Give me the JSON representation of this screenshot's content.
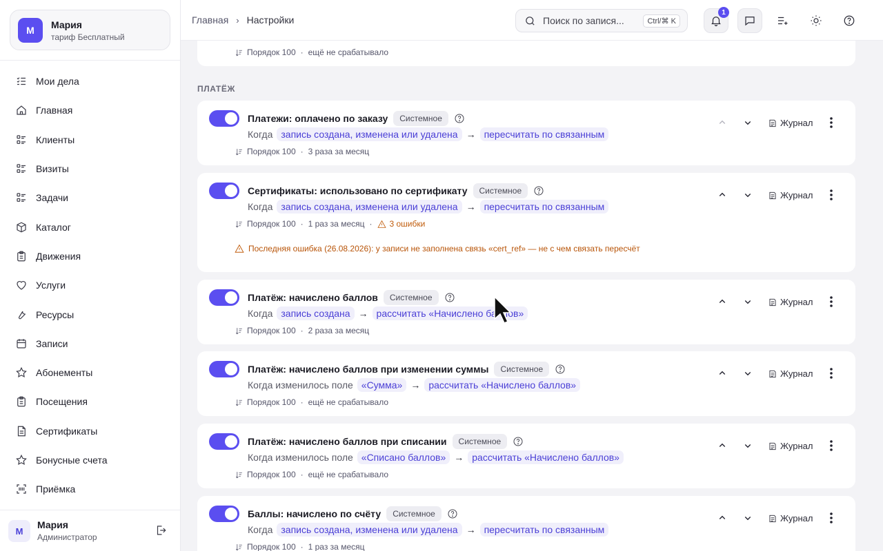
{
  "account": {
    "avatar": "М",
    "name": "Мария",
    "plan": "тариф Бесплатный"
  },
  "nav": [
    {
      "label": "Мои дела",
      "icon": "checklist-icon"
    },
    {
      "label": "Главная",
      "icon": "home-icon"
    },
    {
      "label": "Клиенты",
      "icon": "list-icon"
    },
    {
      "label": "Визиты",
      "icon": "list-icon"
    },
    {
      "label": "Задачи",
      "icon": "list-icon"
    },
    {
      "label": "Каталог",
      "icon": "box-icon"
    },
    {
      "label": "Движения",
      "icon": "clipboard-icon"
    },
    {
      "label": "Услуги",
      "icon": "heart-icon"
    },
    {
      "label": "Ресурсы",
      "icon": "wrench-icon"
    },
    {
      "label": "Записи",
      "icon": "calendar-icon"
    },
    {
      "label": "Абонементы",
      "icon": "star-icon"
    },
    {
      "label": "Посещения",
      "icon": "clipboard-icon"
    },
    {
      "label": "Сертификаты",
      "icon": "document-icon"
    },
    {
      "label": "Бонусные счета",
      "icon": "star-icon"
    },
    {
      "label": "Приёмка",
      "icon": "scan-icon"
    }
  ],
  "user": {
    "avatar": "М",
    "name": "Мария",
    "role": "Администратор"
  },
  "breadcrumb": {
    "home": "Главная",
    "current": "Настройки"
  },
  "search": {
    "placeholder": "Поиск по запися...",
    "shortcut": "Ctrl/⌘ K"
  },
  "notifications": {
    "count": "1"
  },
  "section": "ПЛАТЁЖ",
  "top_partial": {
    "order": "Порядок 100",
    "runs": "ещё не срабатывало"
  },
  "rules": [
    {
      "title": "Платежи: оплачено по заказу",
      "badge": "Системное",
      "when": "Когда",
      "trigger": "запись создана, изменена или удалена",
      "action": "пересчитать по связанным",
      "order": "Порядок 100",
      "runs": "3 раза за месяц",
      "up_disabled": true
    },
    {
      "title": "Сертификаты: использовано по сертификату",
      "badge": "Системное",
      "when": "Когда",
      "trigger": "запись создана, изменена или удалена",
      "action": "пересчитать по связанным",
      "order": "Порядок 100",
      "runs": "1 раз за месяц",
      "errors": "3 ошибки",
      "last_error": "Последняя ошибка (26.08.2026): у записи не заполнена связь «cert_ref» — не с чем связать пересчёт"
    },
    {
      "title": "Платёж: начислено баллов",
      "badge": "Системное",
      "when": "Когда",
      "trigger": "запись создана",
      "action": "рассчитать «Начислено баллов»",
      "order": "Порядок 100",
      "runs": "2 раза за месяц"
    },
    {
      "title": "Платёж: начислено баллов при изменении суммы",
      "badge": "Системное",
      "when": "Когда изменилось поле",
      "trigger": "«Сумма»",
      "action": "рассчитать «Начислено баллов»",
      "order": "Порядок 100",
      "runs": "ещё не срабатывало"
    },
    {
      "title": "Платёж: начислено баллов при списании",
      "badge": "Системное",
      "when": "Когда изменилось поле",
      "trigger": "«Списано баллов»",
      "action": "рассчитать «Начислено баллов»",
      "order": "Порядок 100",
      "runs": "ещё не срабатывало"
    },
    {
      "title": "Баллы: начислено по счёту",
      "badge": "Системное",
      "when": "Когда",
      "trigger": "запись создана, изменена или удалена",
      "action": "пересчитать по связанным",
      "order": "Порядок 100",
      "runs": "1 раз за месяц"
    }
  ],
  "labels": {
    "journal": "Журнал",
    "arrow": "→",
    "dot": "·"
  }
}
